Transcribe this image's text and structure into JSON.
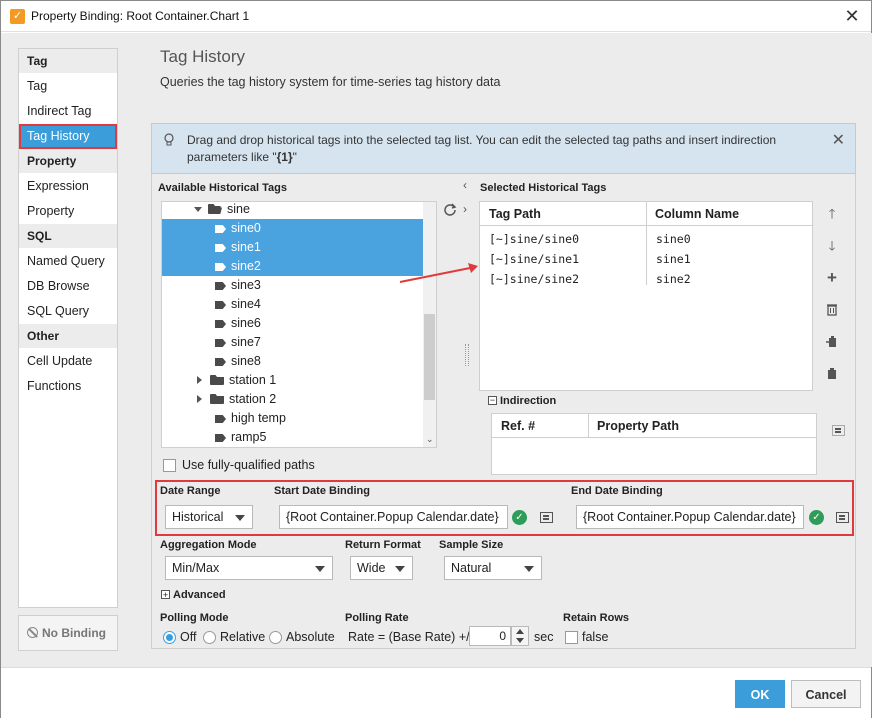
{
  "window": {
    "title": "Property Binding: Root Container.Chart 1",
    "app_icon": "ignition-icon",
    "close_icon": "close-icon"
  },
  "nav": {
    "groups": [
      {
        "header": "Tag",
        "items": [
          "Tag",
          "Indirect Tag",
          "Tag History"
        ]
      },
      {
        "header": "Property",
        "items": [
          "Expression",
          "Property"
        ]
      },
      {
        "header": "SQL",
        "items": [
          "Named Query",
          "DB Browse",
          "SQL Query"
        ]
      },
      {
        "header": "Other",
        "items": [
          "Cell Update",
          "Functions"
        ]
      }
    ],
    "selected": "Tag History",
    "no_binding_label": "No Binding"
  },
  "main": {
    "title": "Tag History",
    "subtitle": "Queries the tag history system for time-series tag history data"
  },
  "info": {
    "text_part1": "Drag and drop historical tags into the selected tag list. You can edit the selected tag paths and insert indirection parameters like \"",
    "text_bold": "{1}",
    "text_part2": "\""
  },
  "available": {
    "label": "Available Historical Tags",
    "tree": [
      {
        "label": "sine",
        "type": "folder-open"
      },
      {
        "label": "sine0",
        "type": "tag",
        "selected": true
      },
      {
        "label": "sine1",
        "type": "tag",
        "selected": true
      },
      {
        "label": "sine2",
        "type": "tag",
        "selected": true
      },
      {
        "label": "sine3",
        "type": "tag"
      },
      {
        "label": "sine4",
        "type": "tag"
      },
      {
        "label": "sine6",
        "type": "tag"
      },
      {
        "label": "sine7",
        "type": "tag"
      },
      {
        "label": "sine8",
        "type": "tag"
      },
      {
        "label": "station 1",
        "type": "folder"
      },
      {
        "label": "station 2",
        "type": "folder"
      },
      {
        "label": "high temp",
        "type": "tag"
      },
      {
        "label": "ramp5",
        "type": "tag"
      }
    ],
    "fully_qualified_label": "Use fully-qualified paths",
    "fully_qualified_checked": false
  },
  "selected": {
    "label": "Selected Historical Tags",
    "columns": [
      "Tag Path",
      "Column Name"
    ],
    "rows": [
      {
        "path": "[~]sine/sine0",
        "column": "sine0"
      },
      {
        "path": "[~]sine/sine1",
        "column": "sine1"
      },
      {
        "path": "[~]sine/sine2",
        "column": "sine2"
      }
    ]
  },
  "indirection": {
    "label": "Indirection",
    "columns": [
      "Ref. #",
      "Property Path"
    ]
  },
  "dates": {
    "range_label": "Date Range",
    "range_value": "Historical",
    "start_label": "Start Date Binding",
    "start_value": "{Root Container.Popup Calendar.date}",
    "end_label": "End Date Binding",
    "end_value": "{Root Container.Popup Calendar.date}"
  },
  "aggregation": {
    "label": "Aggregation Mode",
    "value": "Min/Max"
  },
  "return_format": {
    "label": "Return Format",
    "value": "Wide"
  },
  "sample_size": {
    "label": "Sample Size",
    "value": "Natural"
  },
  "advanced_label": "Advanced",
  "polling": {
    "mode_label": "Polling Mode",
    "options": [
      "Off",
      "Relative",
      "Absolute"
    ],
    "selected": "Off",
    "rate_label": "Polling Rate",
    "rate_prefix": "Rate = (Base Rate) +/-",
    "rate_value": "0",
    "rate_suffix": "sec"
  },
  "retain": {
    "label": "Retain Rows",
    "value": "false"
  },
  "buttons": {
    "ok": "OK",
    "cancel": "Cancel"
  },
  "colors": {
    "accent": "#3c9ddb",
    "highlight_border": "#e0393e",
    "ok_check": "#2e9d5a"
  }
}
